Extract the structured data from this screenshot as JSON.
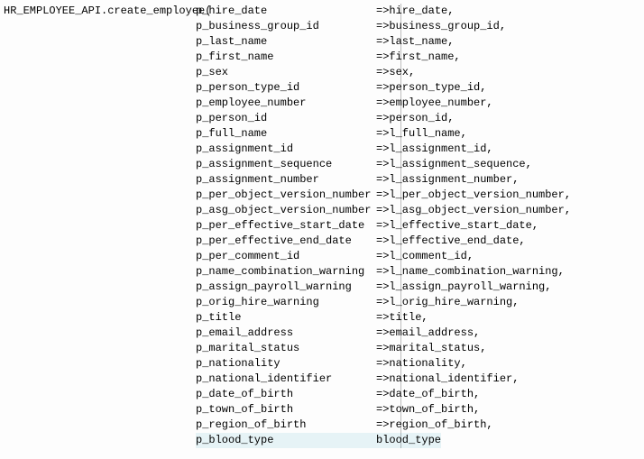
{
  "call": {
    "prefix": "HR_EMPLOYEE_API.create_employee(",
    "arrow": "=>",
    "comma": ",",
    "lines": [
      {
        "param": "p_hire_date",
        "value": "hire_date"
      },
      {
        "param": "p_business_group_id",
        "value": "business_group_id"
      },
      {
        "param": "p_last_name",
        "value": "last_name"
      },
      {
        "param": "p_first_name",
        "value": "first_name"
      },
      {
        "param": "p_sex",
        "value": "sex"
      },
      {
        "param": "p_person_type_id",
        "value": "person_type_id"
      },
      {
        "param": "p_employee_number",
        "value": "employee_number"
      },
      {
        "param": "p_person_id",
        "value": "person_id"
      },
      {
        "param": "p_full_name",
        "value": "l_full_name"
      },
      {
        "param": "p_assignment_id",
        "value": "l_assignment_id"
      },
      {
        "param": "p_assignment_sequence",
        "value": "l_assignment_sequence"
      },
      {
        "param": "p_assignment_number",
        "value": "l_assignment_number"
      },
      {
        "param": "p_per_object_version_number",
        "value": "l_per_object_version_number"
      },
      {
        "param": "p_asg_object_version_number",
        "value": "l_asg_object_version_number"
      },
      {
        "param": "p_per_effective_start_date",
        "value": "l_effective_start_date"
      },
      {
        "param": "p_per_effective_end_date",
        "value": "l_effective_end_date"
      },
      {
        "param": "p_per_comment_id",
        "value": "l_comment_id"
      },
      {
        "param": "p_name_combination_warning",
        "value": "l_name_combination_warning"
      },
      {
        "param": "p_assign_payroll_warning",
        "value": "l_assign_payroll_warning"
      },
      {
        "param": "p_orig_hire_warning",
        "value": "l_orig_hire_warning"
      },
      {
        "param": "p_title",
        "value": "title"
      },
      {
        "param": "p_email_address",
        "value": "email_address"
      },
      {
        "param": "p_marital_status",
        "value": "marital_status"
      },
      {
        "param": "p_nationality",
        "value": "nationality"
      },
      {
        "param": "p_national_identifier",
        "value": "national_identifier"
      },
      {
        "param": "p_date_of_birth",
        "value": "date_of_birth"
      },
      {
        "param": "p_town_of_birth",
        "value": "town_of_birth"
      },
      {
        "param": "p_region_of_birth",
        "value": "region_of_birth"
      },
      {
        "param": "p_blood_type",
        "value": "blood_type"
      }
    ],
    "highlight_index": 28
  }
}
